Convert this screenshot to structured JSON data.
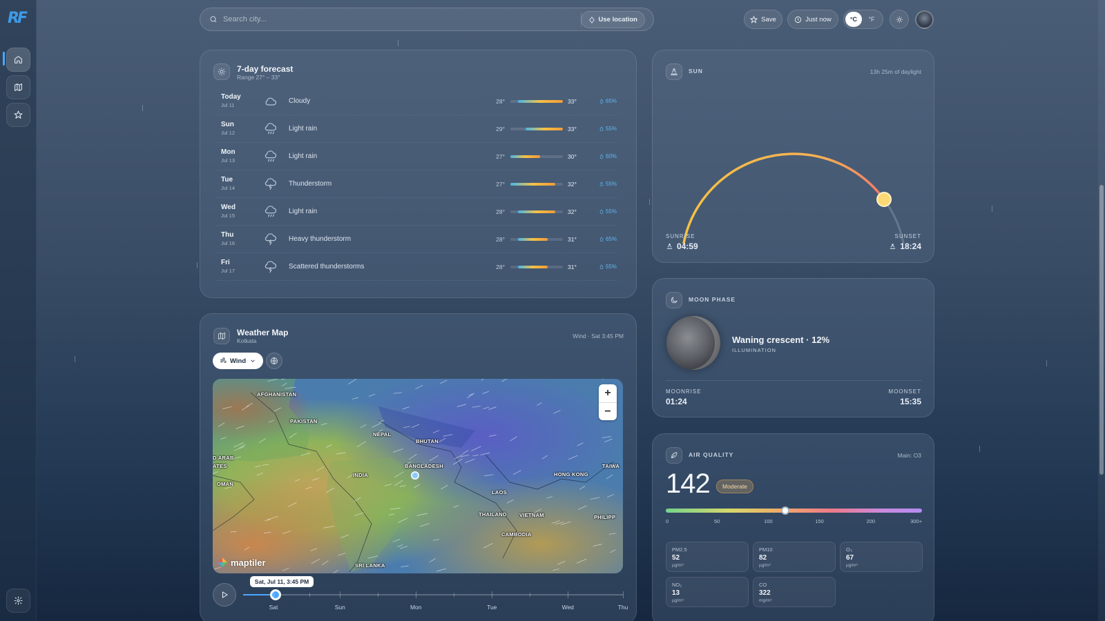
{
  "app": {
    "logo": "RF"
  },
  "search": {
    "placeholder": "Search city...",
    "use_location": "Use location"
  },
  "header": {
    "save": "Save",
    "updated": "Just now",
    "unit_c": "°C",
    "unit_f": "°F"
  },
  "forecast": {
    "title": "7-day forecast",
    "range": "Range 27° – 33°",
    "days": [
      {
        "day": "Today",
        "date": "Jul 11",
        "icon": "cloud-icon",
        "cond": "Cloudy",
        "lo": "28°",
        "hi": "33°",
        "pop": "65%",
        "lo_val": 28,
        "hi_val": 33
      },
      {
        "day": "Sun",
        "date": "Jul 12",
        "icon": "rain-icon",
        "cond": "Light rain",
        "lo": "29°",
        "hi": "33°",
        "pop": "55%",
        "lo_val": 29,
        "hi_val": 33
      },
      {
        "day": "Mon",
        "date": "Jul 13",
        "icon": "rain-icon",
        "cond": "Light rain",
        "lo": "27°",
        "hi": "30°",
        "pop": "60%",
        "lo_val": 27,
        "hi_val": 30
      },
      {
        "day": "Tue",
        "date": "Jul 14",
        "icon": "thunderstorm-icon",
        "cond": "Thunderstorm",
        "lo": "27°",
        "hi": "32°",
        "pop": "55%",
        "lo_val": 27,
        "hi_val": 32
      },
      {
        "day": "Wed",
        "date": "Jul 15",
        "icon": "rain-icon",
        "cond": "Light rain",
        "lo": "28°",
        "hi": "32°",
        "pop": "55%",
        "lo_val": 28,
        "hi_val": 32
      },
      {
        "day": "Thu",
        "date": "Jul 16",
        "icon": "thunderstorm-icon",
        "cond": "Heavy thunderstorm",
        "lo": "28°",
        "hi": "31°",
        "pop": "65%",
        "lo_val": 28,
        "hi_val": 31
      },
      {
        "day": "Fri",
        "date": "Jul 17",
        "icon": "thunderstorm-icon",
        "cond": "Scattered thunderstorms",
        "lo": "28°",
        "hi": "31°",
        "pop": "55%",
        "lo_val": 28,
        "hi_val": 31
      }
    ],
    "scale_min": 27,
    "scale_max": 33
  },
  "map": {
    "title": "Weather Map",
    "city": "Kolkata",
    "layer_info": "Wind · Sat 3:45 PM",
    "layer_button": "Wind",
    "labels": [
      "AFGHANISTAN",
      "PAKISTAN",
      "NEPAL",
      "BHUTAN",
      "BANGLADESH",
      "INDIA",
      "D ARAB",
      "ATES",
      "OMAN",
      "HONG KONG",
      "TAIWA",
      "LAOS",
      "THAILAND",
      "VIETNAM",
      "CAMBODIA",
      "PHILIPP",
      "SRI LANKA"
    ],
    "attribution": "maptiler",
    "zoom_in": "+",
    "zoom_out": "−",
    "timeline": {
      "tooltip": "Sat, Jul 11, 3:45 PM",
      "days": [
        "Sat",
        "Sun",
        "Mon",
        "Tue",
        "Wed",
        "Thu"
      ],
      "progress": 0.085
    }
  },
  "sun": {
    "label": "SUN",
    "daylight": "13h 25m of daylight",
    "sunrise_label": "SUNRISE",
    "sunrise": "04:59",
    "sunset_label": "SUNSET",
    "sunset": "18:24",
    "progress": 0.8
  },
  "moon": {
    "label": "MOON PHASE",
    "phase": "Waning crescent · 12%",
    "illum_label": "ILLUMINATION",
    "moonrise_label": "MOONRISE",
    "moonrise": "01:24",
    "moonset_label": "MOONSET",
    "moonset": "15:35"
  },
  "air": {
    "label": "AIR QUALITY",
    "main": "Main: O3",
    "aqi": "142",
    "category": "Moderate",
    "scale_labels": [
      "0",
      "50",
      "100",
      "150",
      "200",
      "300+"
    ],
    "aqi_fraction": 0.467,
    "pollutants": [
      {
        "name": "PM2.5",
        "value": "52",
        "unit": "µg/m³"
      },
      {
        "name": "PM10",
        "value": "82",
        "unit": "µg/m³"
      },
      {
        "name": "O₃",
        "value": "67",
        "unit": "µg/m³"
      },
      {
        "name": "NO₂",
        "value": "13",
        "unit": "µg/m³"
      },
      {
        "name": "CO",
        "value": "322",
        "unit": "mg/m³"
      }
    ]
  },
  "colors": {
    "accent": "#4aa8ff",
    "sun_arc": "#f6c244",
    "rain": "#5fb5f0"
  }
}
